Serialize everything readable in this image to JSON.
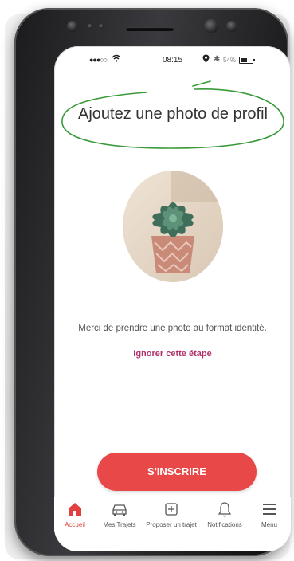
{
  "status_bar": {
    "signal": "●●●○○",
    "wifi": "wifi",
    "time": "08:15",
    "battery_text": "54%",
    "battery_level": 0.54
  },
  "onboarding": {
    "title": "Ajoutez une photo de profil",
    "instruction": "Merci de prendre une photo au format identité.",
    "skip_label": "Ignorer cette étape",
    "signup_label": "S'INSCRIRE"
  },
  "tabbar": {
    "items": [
      {
        "label": "Accueil",
        "icon": "home-icon",
        "active": true
      },
      {
        "label": "Mes Trajets",
        "icon": "car-icon",
        "active": false
      },
      {
        "label": "Proposer un trajet",
        "icon": "plus-box-icon",
        "active": false
      },
      {
        "label": "Notifications",
        "icon": "bell-icon",
        "active": false
      },
      {
        "label": "Menu",
        "icon": "menu-icon",
        "active": false
      }
    ]
  },
  "colors": {
    "accent": "#e84848",
    "link": "#b0306a",
    "title_highlight": "#3a9a3a"
  }
}
